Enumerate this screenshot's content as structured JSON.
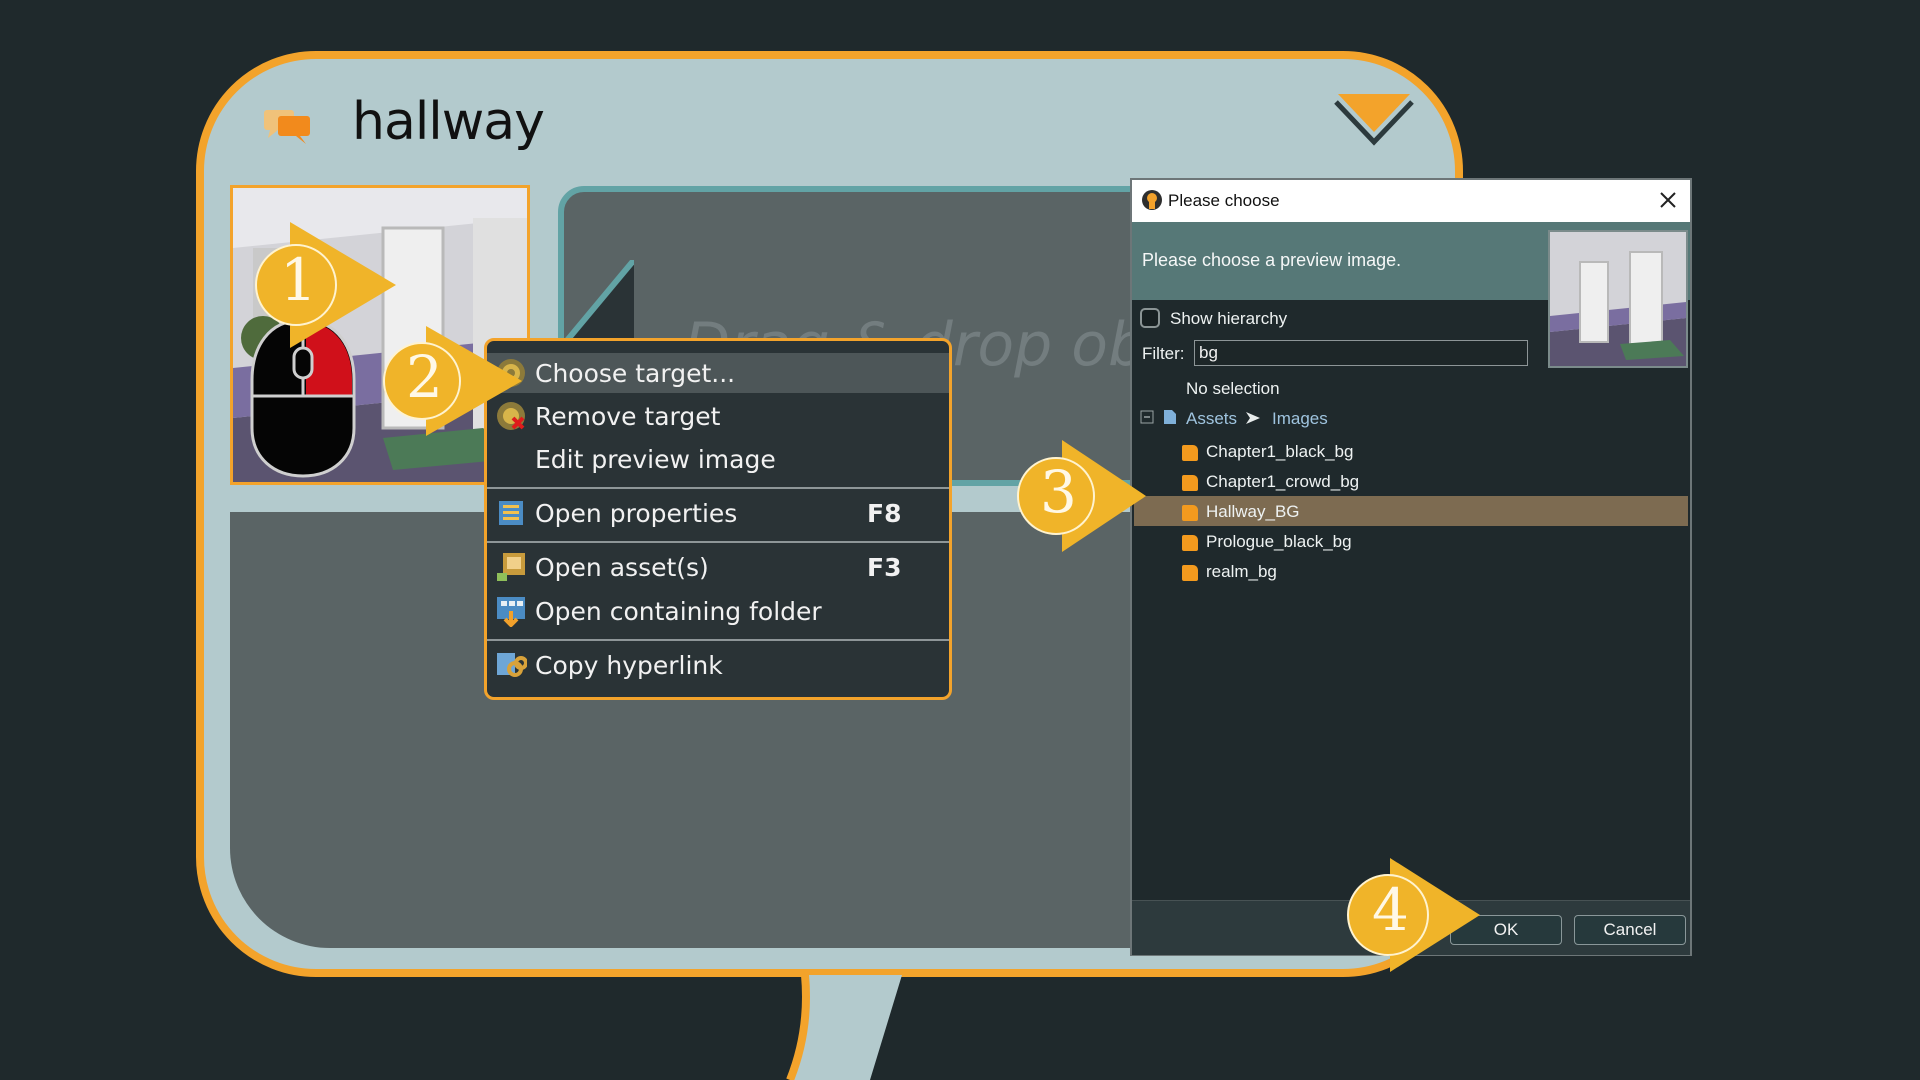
{
  "card": {
    "title": "hallway",
    "icon": "speech-bubbles-icon",
    "collapse_icon": "chevron-down-icon",
    "drop_hint": "Drag & drop obje"
  },
  "context_menu": {
    "items": [
      {
        "label": "Choose target...",
        "icon": "target-icon",
        "shortcut": ""
      },
      {
        "label": "Remove target",
        "icon": "remove-target-icon",
        "shortcut": ""
      },
      {
        "label": "Edit preview image",
        "icon": "",
        "shortcut": ""
      },
      {
        "label": "Open properties",
        "icon": "properties-icon",
        "shortcut": "F8"
      },
      {
        "label": "Open asset(s)",
        "icon": "open-asset-icon",
        "shortcut": "F3"
      },
      {
        "label": "Open containing folder",
        "icon": "folder-icon",
        "shortcut": ""
      },
      {
        "label": "Copy hyperlink",
        "icon": "hyperlink-icon",
        "shortcut": ""
      }
    ]
  },
  "dialog": {
    "title": "Please choose",
    "prompt": "Please choose a preview image.",
    "show_hierarchy_label": "Show hierarchy",
    "show_hierarchy_checked": false,
    "filter_label": "Filter:",
    "filter_value": "bg",
    "no_selection": "No selection",
    "breadcrumb": {
      "root": "Assets",
      "child": "Images"
    },
    "files": [
      {
        "name": "Chapter1_black_bg",
        "selected": false
      },
      {
        "name": "Chapter1_crowd_bg",
        "selected": false
      },
      {
        "name": "Hallway_BG",
        "selected": true
      },
      {
        "name": "Prologue_black_bg",
        "selected": false
      },
      {
        "name": "realm_bg",
        "selected": false
      }
    ],
    "ok_label": "OK",
    "cancel_label": "Cancel"
  },
  "steps": [
    "1",
    "2",
    "3",
    "4"
  ],
  "colors": {
    "accent": "#f3a32b",
    "card_bg": "#b3cacd",
    "background": "#1f292c",
    "selection": "#7d6b51"
  }
}
